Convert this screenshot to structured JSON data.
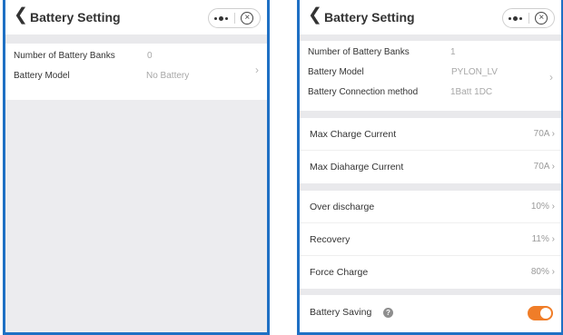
{
  "left_screen": {
    "title": "Battery Setting",
    "rows": [
      {
        "label": "Number of  Battery Banks",
        "value": "0"
      },
      {
        "label": "Battery Model",
        "value": "No Battery"
      }
    ],
    "chevron": "›"
  },
  "right_screen": {
    "title": "Battery Setting",
    "info_rows": [
      {
        "label": "Number of  Battery Banks",
        "value": "1"
      },
      {
        "label": "Battery Model",
        "value": "PYLON_LV"
      },
      {
        "label": "Battery Connection method",
        "value": "1Batt 1DC"
      }
    ],
    "info_chevron": "›",
    "current_rows": [
      {
        "label": "Max Charge Current",
        "value": "70A ›"
      },
      {
        "label": "Max Diaharge Current",
        "value": "70A ›"
      }
    ],
    "level_rows": [
      {
        "label": "Over discharge",
        "value": "10% ›"
      },
      {
        "label": "Recovery",
        "value": "11% ›"
      },
      {
        "label": "Force Charge",
        "value": "80% ›"
      }
    ],
    "battery_saving": {
      "label": "Battery Saving",
      "enabled": true
    }
  },
  "icons": {
    "back": "chevron-left",
    "more": "dots-horizontal",
    "close": "circle-x",
    "help": "question-circle"
  },
  "colors": {
    "accent": "#f07d28",
    "frame": "#1f70c4",
    "background": "#e9e9ec"
  }
}
